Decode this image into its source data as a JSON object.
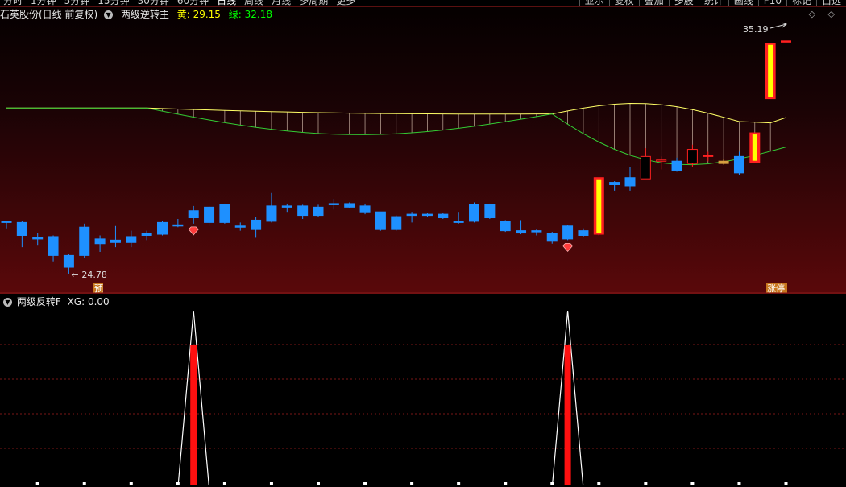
{
  "topbar": {
    "tabs": [
      "分时",
      "1分钟",
      "5分钟",
      "15分钟",
      "30分钟",
      "60分钟",
      "日线",
      "周线",
      "月线",
      "多周期",
      "更多"
    ],
    "active_tab": "日线",
    "right_tabs": [
      "亚示",
      "复权",
      "叠加",
      "多股",
      "统计",
      "画线",
      "F10",
      "标记",
      "自选"
    ]
  },
  "main_panel": {
    "stock_name": "石英股份(日线 前复权)",
    "indicator_name": "两级逆转主",
    "yellow_label": "黄:",
    "yellow_value": "29.15",
    "green_label": "绿:",
    "green_value": "32.18",
    "high_label": "35.19",
    "low_label": "24.78",
    "tag_pre": "预",
    "tag_limit": "涨停",
    "controls": "◇ ◇",
    "colors": {
      "up_hollow": "#ff2020",
      "down": "#1e90ff",
      "limit_fill": "#ffff00",
      "line_yellow": "#ffff66",
      "line_green": "#33cc33",
      "doji": "#d6a040"
    }
  },
  "sub_panel": {
    "name": "两级反转F",
    "xg_label": "XG: 0.00"
  },
  "chart_data": [
    {
      "type": "candlestick",
      "title": "石英股份(日线 前复权)",
      "series_lines": [
        {
          "name": "黄",
          "last_value": 29.15
        },
        {
          "name": "绿",
          "last_value": 32.18
        }
      ],
      "candles": [
        {
          "o": 27.0,
          "h": 27.0,
          "l": 26.7,
          "c": 26.95,
          "d": "down"
        },
        {
          "o": 26.95,
          "h": 27.0,
          "l": 25.9,
          "c": 26.4,
          "d": "down"
        },
        {
          "o": 26.3,
          "h": 26.5,
          "l": 26.0,
          "c": 26.25,
          "d": "down"
        },
        {
          "o": 26.35,
          "h": 26.4,
          "l": 25.3,
          "c": 25.55,
          "d": "down"
        },
        {
          "o": 25.55,
          "h": 25.6,
          "l": 24.78,
          "c": 25.05,
          "d": "down"
        },
        {
          "o": 25.55,
          "h": 26.9,
          "l": 25.45,
          "c": 26.75,
          "d": "up_blue"
        },
        {
          "o": 26.25,
          "h": 26.4,
          "l": 25.7,
          "c": 26.05,
          "d": "down"
        },
        {
          "o": 26.2,
          "h": 26.8,
          "l": 25.9,
          "c": 26.1,
          "d": "down"
        },
        {
          "o": 26.35,
          "h": 26.6,
          "l": 25.9,
          "c": 26.1,
          "d": "down"
        },
        {
          "o": 26.4,
          "h": 26.6,
          "l": 26.2,
          "c": 26.5,
          "d": "down"
        },
        {
          "o": 26.45,
          "h": 27.0,
          "l": 26.4,
          "c": 26.95,
          "d": "down"
        },
        {
          "o": 26.85,
          "h": 27.1,
          "l": 26.75,
          "c": 26.85,
          "d": "down"
        },
        {
          "o": 27.15,
          "h": 27.65,
          "l": 26.9,
          "c": 27.45,
          "d": "down"
        },
        {
          "o": 27.6,
          "h": 27.65,
          "l": 26.8,
          "c": 26.95,
          "d": "down"
        },
        {
          "o": 26.95,
          "h": 27.75,
          "l": 26.9,
          "c": 27.7,
          "d": "up_blue"
        },
        {
          "o": 26.8,
          "h": 26.95,
          "l": 26.6,
          "c": 26.75,
          "d": "down"
        },
        {
          "o": 26.65,
          "h": 27.2,
          "l": 26.3,
          "c": 27.05,
          "d": "up_blue"
        },
        {
          "o": 27.0,
          "h": 28.2,
          "l": 26.95,
          "c": 27.65,
          "d": "up_blue"
        },
        {
          "o": 27.65,
          "h": 27.75,
          "l": 27.4,
          "c": 27.6,
          "d": "down"
        },
        {
          "o": 27.65,
          "h": 27.7,
          "l": 27.1,
          "c": 27.25,
          "d": "down"
        },
        {
          "o": 27.6,
          "h": 27.7,
          "l": 27.2,
          "c": 27.25,
          "d": "down"
        },
        {
          "o": 27.7,
          "h": 27.95,
          "l": 27.5,
          "c": 27.75,
          "d": "down"
        },
        {
          "o": 27.75,
          "h": 27.8,
          "l": 27.55,
          "c": 27.6,
          "d": "down"
        },
        {
          "o": 27.65,
          "h": 27.75,
          "l": 27.3,
          "c": 27.4,
          "d": "down"
        },
        {
          "o": 27.4,
          "h": 27.4,
          "l": 26.6,
          "c": 26.65,
          "d": "down"
        },
        {
          "o": 27.2,
          "h": 27.25,
          "l": 26.6,
          "c": 26.65,
          "d": "down"
        },
        {
          "o": 27.3,
          "h": 27.4,
          "l": 26.95,
          "c": 27.25,
          "d": "down"
        },
        {
          "o": 27.3,
          "h": 27.35,
          "l": 27.2,
          "c": 27.25,
          "d": "down"
        },
        {
          "o": 27.3,
          "h": 27.35,
          "l": 27.1,
          "c": 27.15,
          "d": "down"
        },
        {
          "o": 27.0,
          "h": 27.4,
          "l": 26.9,
          "c": 26.95,
          "d": "down"
        },
        {
          "o": 27.0,
          "h": 27.8,
          "l": 26.95,
          "c": 27.7,
          "d": "up_blue"
        },
        {
          "o": 27.7,
          "h": 27.75,
          "l": 27.1,
          "c": 27.15,
          "d": "down"
        },
        {
          "o": 27.0,
          "h": 27.05,
          "l": 26.55,
          "c": 26.6,
          "d": "down"
        },
        {
          "o": 26.6,
          "h": 27.05,
          "l": 26.45,
          "c": 26.5,
          "d": "down"
        },
        {
          "o": 26.6,
          "h": 26.65,
          "l": 26.4,
          "c": 26.55,
          "d": "down"
        },
        {
          "o": 26.5,
          "h": 26.55,
          "l": 26.05,
          "c": 26.15,
          "d": "down"
        },
        {
          "o": 26.25,
          "h": 26.85,
          "l": 26.2,
          "c": 26.8,
          "d": "up_blue"
        },
        {
          "o": 26.6,
          "h": 26.7,
          "l": 26.35,
          "c": 26.4,
          "d": "down"
        },
        {
          "o": 26.45,
          "h": 28.85,
          "l": 26.4,
          "c": 28.85,
          "d": "limit"
        },
        {
          "o": 28.55,
          "h": 28.7,
          "l": 28.3,
          "c": 28.65,
          "d": "up_blue"
        },
        {
          "o": 28.5,
          "h": 29.3,
          "l": 28.3,
          "c": 28.85,
          "d": "up_blue"
        },
        {
          "o": 28.8,
          "h": 30.1,
          "l": 28.8,
          "c": 29.75,
          "d": "up_red"
        },
        {
          "o": 29.6,
          "h": 29.75,
          "l": 29.2,
          "c": 29.6,
          "d": "up_red"
        },
        {
          "o": 29.55,
          "h": 29.7,
          "l": 29.1,
          "c": 29.15,
          "d": "down"
        },
        {
          "o": 29.45,
          "h": 30.25,
          "l": 29.3,
          "c": 30.05,
          "d": "up_red"
        },
        {
          "o": 29.75,
          "h": 29.95,
          "l": 29.55,
          "c": 29.8,
          "d": "up_red_fill"
        },
        {
          "o": 29.55,
          "h": 29.65,
          "l": 29.4,
          "c": 29.45,
          "d": "doji"
        },
        {
          "o": 29.75,
          "h": 29.95,
          "l": 28.95,
          "c": 29.05,
          "d": "down"
        },
        {
          "o": 29.5,
          "h": 30.75,
          "l": 29.5,
          "c": 30.75,
          "d": "limit"
        },
        {
          "o": 32.2,
          "h": 34.55,
          "l": 32.2,
          "c": 34.55,
          "d": "limit"
        },
        {
          "o": 34.65,
          "h": 35.19,
          "l": 33.3,
          "c": 34.65,
          "d": "up_red_fill"
        }
      ],
      "ylim": [
        24.3,
        35.6
      ],
      "low_marker": 24.78,
      "high_marker": 35.19,
      "signal_candles": [
        12,
        36
      ]
    },
    {
      "type": "line",
      "title": "两级反转F",
      "series": [
        {
          "name": "XG",
          "values_at": [
            12,
            36
          ],
          "peak": 1
        }
      ],
      "ylim": [
        0,
        1
      ]
    }
  ]
}
